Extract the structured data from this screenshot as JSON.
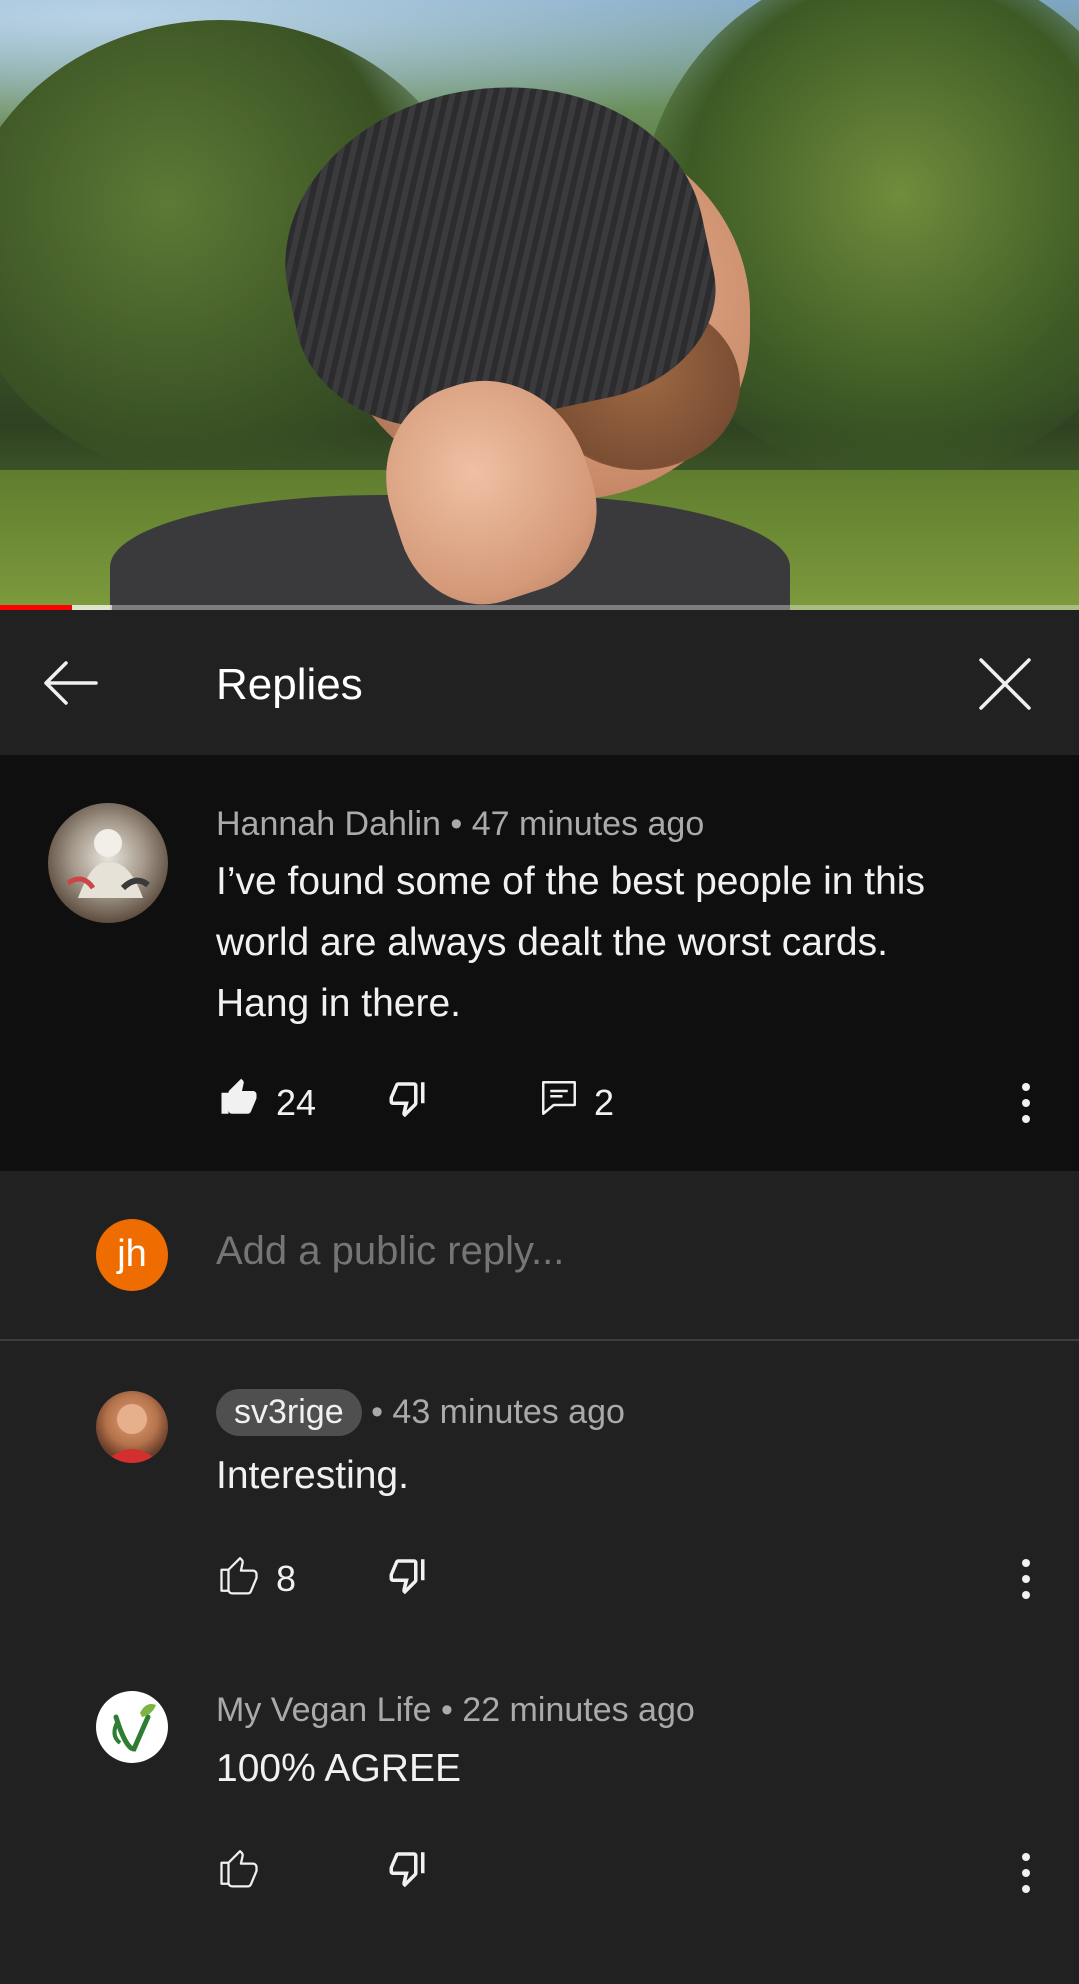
{
  "header": {
    "title": "Replies"
  },
  "main_comment": {
    "author": "Hannah Dahlin",
    "time": "47 minutes ago",
    "text_line1": "I’ve found some of the best people in this",
    "text_line2": "world are always dealt the worst cards.",
    "text_line3": "Hang in there.",
    "likes": "24",
    "replies": "2"
  },
  "reply_box": {
    "avatar_initials": "jh",
    "avatar_color": "#ef6c00",
    "placeholder": "Add a public reply..."
  },
  "replies": [
    {
      "author": "sv3rige",
      "time": "43 minutes ago",
      "text": "Interesting.",
      "likes": "8"
    },
    {
      "author": "My Vegan Life",
      "time": "22 minutes ago",
      "text": "100% AGREE",
      "likes": ""
    }
  ],
  "separator": "•",
  "icons": {
    "back": "arrow-left-icon",
    "close": "close-icon",
    "like": "thumb-up-icon",
    "dislike": "thumb-down-icon",
    "reply": "comment-icon",
    "more": "more-vert-icon"
  },
  "colors": {
    "background": "#212121",
    "highlight": "#0f0f0f",
    "progress": "#ff0000",
    "secondary_text": "#aaaaaa"
  },
  "video_progress": 0.067
}
